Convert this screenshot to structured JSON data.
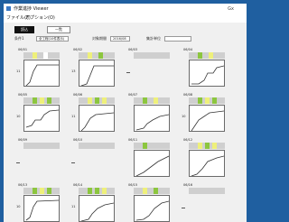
{
  "window": {
    "title": "作業進捗 Viewer",
    "right_label": "Gx",
    "menu": [
      "ファイル(F)",
      "オプション(O)"
    ]
  },
  "toolbar": {
    "primary_button": "読込",
    "secondary_button": "一覧",
    "label1": "条件1",
    "field1": "全工程(10件表示)",
    "label2": "対象期間",
    "field2": "2016/08",
    "label3": "集計単位",
    "field3": ""
  },
  "colors": {
    "desktop": "#1f5fa0",
    "strip_gray": "#cfcfcf",
    "green": "#8cc63e",
    "yellow": "#eef07a",
    "white": "#ffffff",
    "line": "#333333"
  },
  "cells": [
    {
      "title": "06/01",
      "ylabel": "11",
      "pattern": "line1",
      "strip": [
        "y",
        "w"
      ]
    },
    {
      "title": "06/02",
      "ylabel": "13",
      "pattern": "line2",
      "strip": [
        "y",
        "g"
      ]
    },
    {
      "title": "06/03",
      "ylabel": "",
      "pattern": "none",
      "strip": []
    },
    {
      "title": "06/04",
      "ylabel": "",
      "pattern": "line3",
      "strip": [
        "g",
        "y"
      ]
    },
    {
      "title": "06/05",
      "ylabel": "10",
      "pattern": "line4",
      "strip": [
        "g",
        "y",
        "g"
      ]
    },
    {
      "title": "06/06",
      "ylabel": "11",
      "pattern": "line5",
      "strip": [
        "y",
        "g",
        "y"
      ]
    },
    {
      "title": "06/07",
      "ylabel": "",
      "pattern": "line6",
      "strip": [
        "g",
        "y"
      ]
    },
    {
      "title": "06/08",
      "ylabel": "10",
      "pattern": "line7",
      "strip": [
        "g",
        "y",
        "g"
      ]
    },
    {
      "title": "06/09",
      "ylabel": "",
      "pattern": "none",
      "strip": []
    },
    {
      "title": "06/10",
      "ylabel": "",
      "pattern": "none",
      "strip": []
    },
    {
      "title": "06/11",
      "ylabel": "",
      "pattern": "line8",
      "strip": [
        "g"
      ]
    },
    {
      "title": "06/12",
      "ylabel": "",
      "pattern": "line9",
      "strip": [
        "y",
        "g",
        "y"
      ]
    },
    {
      "title": "06/13",
      "ylabel": "10",
      "pattern": "line10",
      "strip": [
        "g",
        "y",
        "g"
      ]
    },
    {
      "title": "06/14",
      "ylabel": "11",
      "pattern": "line11",
      "strip": [
        "g",
        "g",
        "y"
      ]
    },
    {
      "title": "06/15",
      "ylabel": "",
      "pattern": "line12",
      "strip": [
        "y",
        "g"
      ]
    },
    {
      "title": "06/16",
      "ylabel": "",
      "pattern": "none",
      "strip": []
    }
  ]
}
